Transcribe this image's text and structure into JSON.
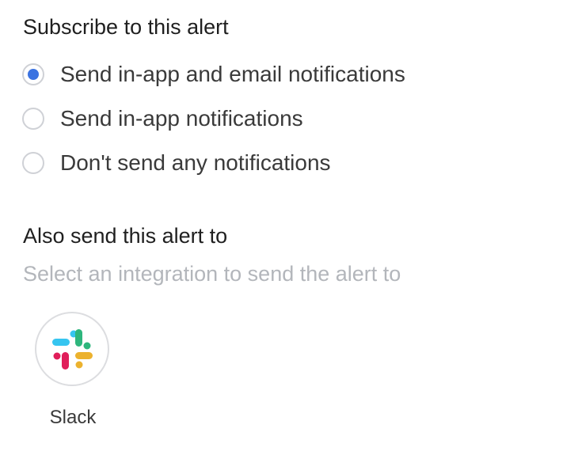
{
  "subscribe": {
    "title": "Subscribe to this alert",
    "options": [
      {
        "label": "Send in-app and email notifications",
        "selected": true
      },
      {
        "label": "Send in-app notifications",
        "selected": false
      },
      {
        "label": "Don't send any notifications",
        "selected": false
      }
    ]
  },
  "also_send": {
    "title": "Also send this alert to",
    "hint": "Select an integration to send the alert to",
    "integrations": [
      {
        "label": "Slack",
        "icon": "slack-icon"
      }
    ]
  },
  "colors": {
    "accent": "#3b73e1",
    "radio_border": "#cfd1d6",
    "hint_text": "#b3b6bb",
    "slack_blue": "#36c5f0",
    "slack_green": "#2eb67d",
    "slack_yellow": "#ecb22e",
    "slack_red": "#e01e5a"
  }
}
